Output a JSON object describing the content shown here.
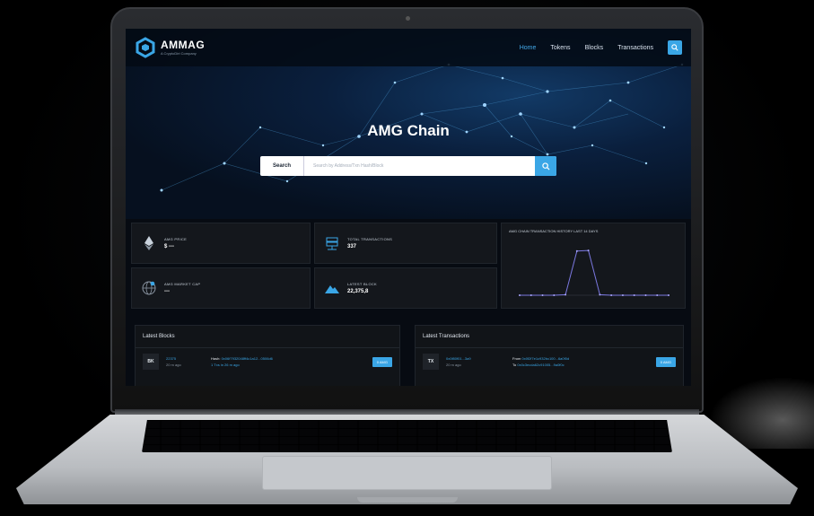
{
  "brand": {
    "name": "AMMAG",
    "tagline": "A CryptoDirt Company"
  },
  "nav": {
    "items": [
      {
        "label": "Home",
        "active": true
      },
      {
        "label": "Tokens",
        "active": false
      },
      {
        "label": "Blocks",
        "active": false
      },
      {
        "label": "Transactions",
        "active": false
      }
    ],
    "search_icon": "search-icon"
  },
  "hero": {
    "title": "AMG Chain",
    "search_label": "Search",
    "search_placeholder": "Search by Address/Txn Hash/Block"
  },
  "stats": {
    "price": {
      "label": "AMG PRICE",
      "value": "$ ---",
      "icon": "ethereum-icon"
    },
    "market_cap": {
      "label": "AMG MARKET CAP",
      "value": "---",
      "icon": "globe-icon"
    },
    "total_tx": {
      "label": "TOTAL TRANSACTIONS",
      "value": "337",
      "icon": "server-icon"
    },
    "latest_block": {
      "label": "LATEST BLOCK",
      "value": "22,375,8",
      "icon": "mountain-icon"
    },
    "chart_title": "AMG CHAIN TRANSACTION HISTORY LAST 14 DAYS"
  },
  "chart_data": {
    "type": "line",
    "title": "AMG CHAIN TRANSACTION HISTORY LAST 14 DAYS",
    "x": [
      1,
      2,
      3,
      4,
      5,
      6,
      7,
      8,
      9,
      10,
      11,
      12,
      13,
      14
    ],
    "values": [
      0,
      0,
      0,
      0,
      2,
      170,
      172,
      2,
      0,
      0,
      0,
      0,
      0,
      0
    ],
    "ylim": [
      0,
      200
    ]
  },
  "latest_blocks": {
    "title": "Latest Blocks",
    "rows": [
      {
        "badge": "BK",
        "number": "22375",
        "age": "20 m ago",
        "hash_label": "Hash:",
        "hash": "0x06f7932048ff4c1a12...0506d6",
        "txns": "1 Txs in 26 m ago",
        "button": "0 AMG"
      }
    ]
  },
  "latest_transactions": {
    "title": "Latest Transactions",
    "rows": [
      {
        "badge": "TX",
        "hash": "0x0f80f01...3a9",
        "age": "20 m ago",
        "from_label": "From",
        "from": "0x0f2f7e1c932bc100...6a0f0d",
        "to_label": "To",
        "to": "0x0c3ecda62c91005...9a0f0c",
        "button": "0 AMG"
      }
    ]
  }
}
